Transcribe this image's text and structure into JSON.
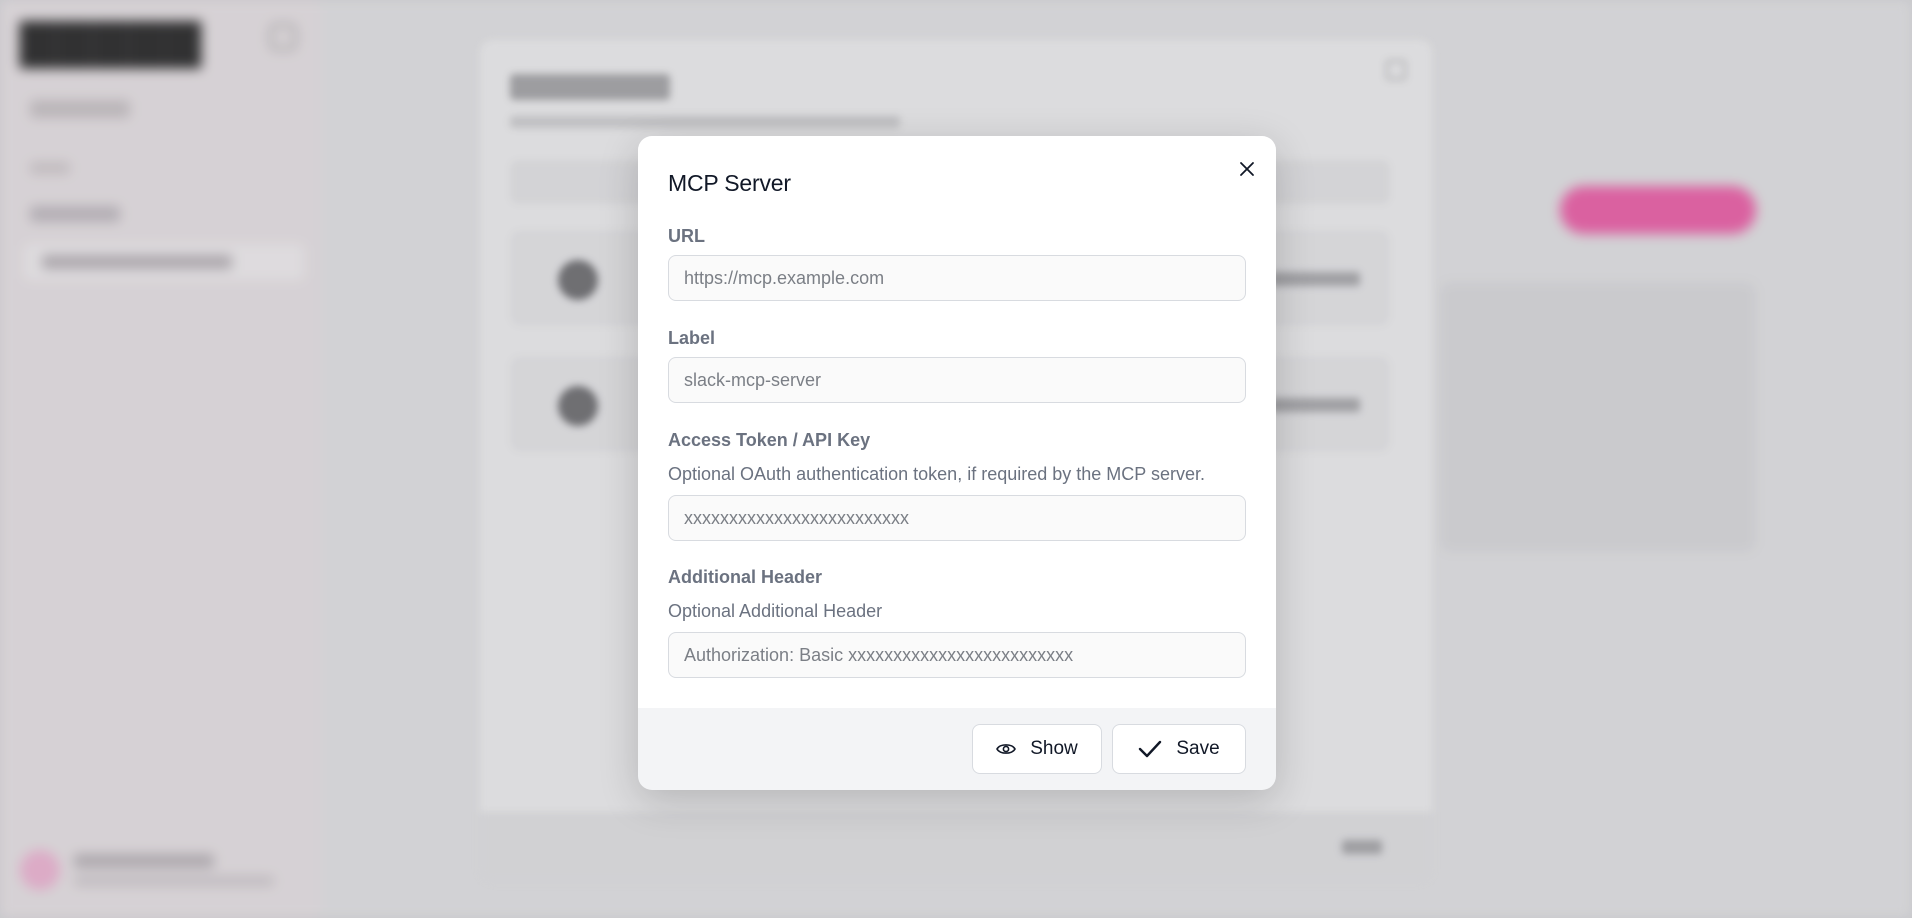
{
  "dialog": {
    "title": "MCP Server",
    "close_icon": "close-icon",
    "fields": {
      "url": {
        "label": "URL",
        "placeholder": "https://mcp.example.com",
        "value": ""
      },
      "label": {
        "label": "Label",
        "placeholder": "slack-mcp-server",
        "value": ""
      },
      "token": {
        "label": "Access Token / API Key",
        "help": "Optional OAuth authentication token, if required by the MCP server.",
        "placeholder": "xxxxxxxxxxxxxxxxxxxxxxxxx",
        "value": ""
      },
      "header": {
        "label": "Additional Header",
        "help": "Optional Additional Header",
        "placeholder": "Authorization: Basic xxxxxxxxxxxxxxxxxxxxxxxxx",
        "value": ""
      }
    },
    "footer": {
      "show_label": "Show",
      "show_icon": "eye-icon",
      "save_label": "Save",
      "save_icon": "check-icon"
    }
  },
  "colors": {
    "text_primary": "#111827",
    "text_muted": "#6b7280",
    "input_border": "#d8dbe0",
    "footer_bg": "#f3f4f6",
    "accent_pink": "#f05ca8"
  }
}
